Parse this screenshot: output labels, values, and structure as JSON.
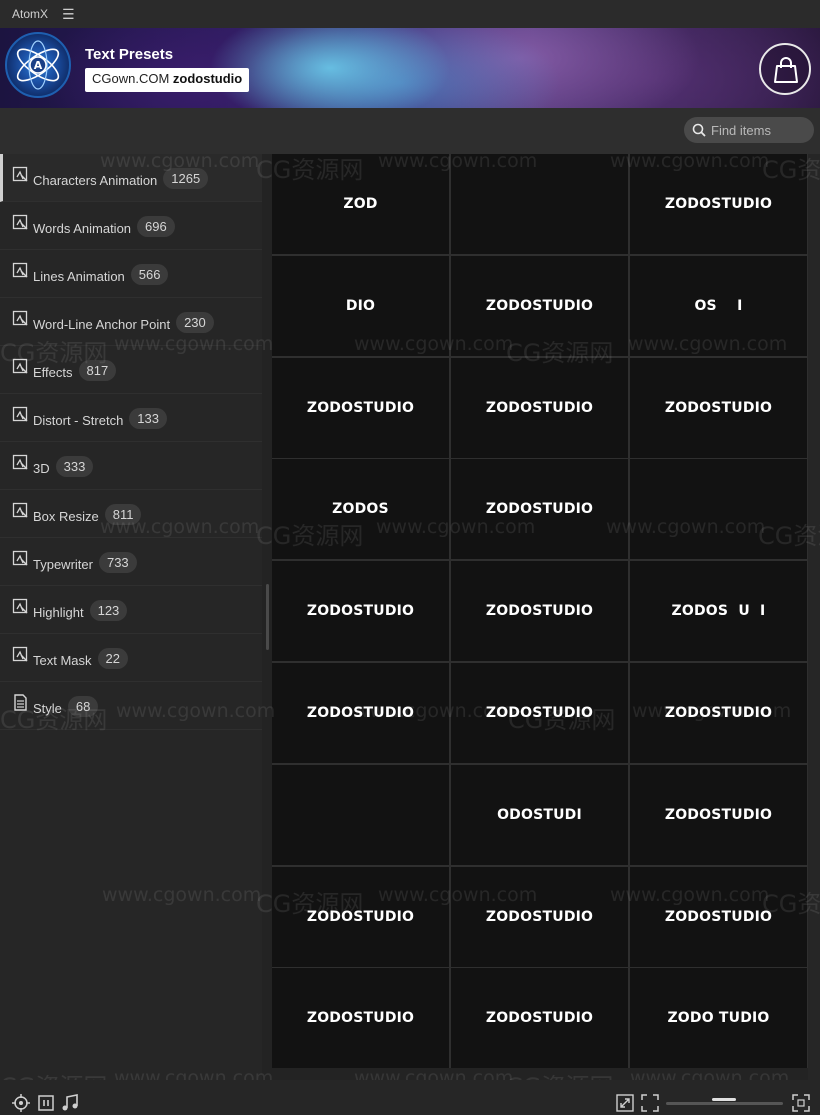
{
  "window": {
    "title": "AtomX",
    "menu_icon": "hamburger-icon"
  },
  "banner": {
    "title": "Text Presets",
    "tag_plain": "CGown.COM ",
    "tag_bold": "zodostudio",
    "logo_letter": "A"
  },
  "toolbar": {
    "icons": [
      "sliders-icon",
      "list-view-icon",
      "play-preview-icon",
      "star-icon"
    ]
  },
  "search": {
    "placeholder": "Find items"
  },
  "sidebar": {
    "items": [
      {
        "label": "Characters Animation",
        "count": "1265",
        "active": true
      },
      {
        "label": "Words Animation",
        "count": "696"
      },
      {
        "label": "Lines Animation",
        "count": "566"
      },
      {
        "label": "Word-Line Anchor Point",
        "count": "230"
      },
      {
        "label": "Effects",
        "count": "817"
      },
      {
        "label": "Distort - Stretch",
        "count": "133"
      },
      {
        "label": "3D",
        "count": "333"
      },
      {
        "label": "Box Resize",
        "count": "811"
      },
      {
        "label": "Typewriter",
        "count": "733"
      },
      {
        "label": "Highlight",
        "count": "123"
      },
      {
        "label": "Text Mask",
        "count": "22"
      },
      {
        "label": "Style",
        "count": "68"
      }
    ]
  },
  "grid": {
    "cells": [
      "ZOD",
      "",
      "ZODOSTUDIO",
      "DIO",
      "ZODOSTUDIO",
      "OS    I",
      "ZODOSTUDIO",
      "ZODOSTUDIO",
      "ZODOSTUDIO",
      "ZODOS",
      "ZODOSTUDIO",
      "",
      "ZODOSTUDIO",
      "ZODOSTUDIO",
      "ZODOS  U  I",
      "ZODOSTUDIO",
      "ZODOSTUDIO",
      "ZODOSTUDIO",
      "",
      "ODOSTUDI",
      "ZODOSTUDIO",
      "ZODOSTUDIO",
      "ZODOSTUDIO",
      "ZODOSTUDIO",
      "ZODOSTUDIO",
      "ZODOSTUDIO",
      "ZODO TUDIO"
    ]
  },
  "watermark": {
    "cn": "CG资源网",
    "url": "www.cgown.com"
  },
  "bottombar": {
    "icons": [
      "target-icon",
      "pause-icon",
      "music-icon",
      "expand-icon",
      "fit-icon",
      "fullscreen-icon"
    ],
    "zoom_level": 0.45
  }
}
